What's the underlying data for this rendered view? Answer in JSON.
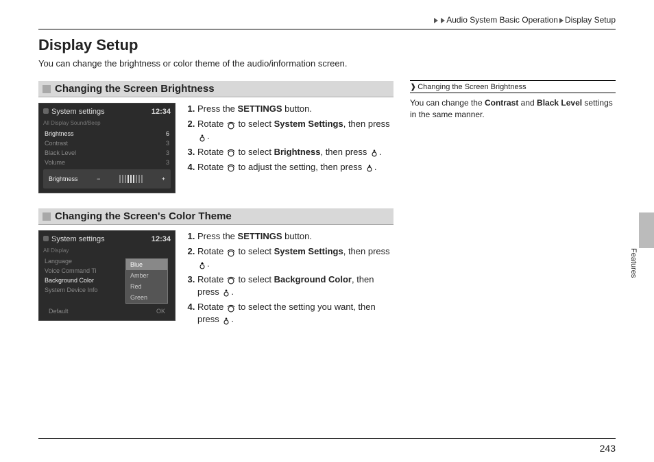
{
  "breadcrumb": {
    "a": "Audio System Basic Operation",
    "b": "Display Setup"
  },
  "title": "Display Setup",
  "intro": "You can change the brightness or color theme of the audio/information screen.",
  "section1": {
    "heading": "Changing the Screen Brightness",
    "screenshot": {
      "header": "System settings",
      "clock": "12:34",
      "tabs": "All     Display     Sound/Beep",
      "rows": [
        {
          "label": "Brightness",
          "val": "6",
          "active": true
        },
        {
          "label": "Contrast",
          "val": "3",
          "active": false
        },
        {
          "label": "Black Level",
          "val": "3",
          "active": false
        },
        {
          "label": "Volume",
          "val": "3",
          "active": false
        }
      ],
      "foot_label": "Brightness",
      "minus": "−",
      "plus": "+"
    },
    "steps": {
      "s1a": "Press the ",
      "s1b": "SETTINGS",
      "s1c": " button.",
      "s2a": "Rotate ",
      "s2b": " to select ",
      "s2c": "System Settings",
      "s2d": ", then press ",
      "s2e": ".",
      "s3a": "Rotate ",
      "s3b": " to select ",
      "s3c": "Brightness",
      "s3d": ", then press ",
      "s3e": ".",
      "s4a": "Rotate ",
      "s4b": " to adjust the setting, then press ",
      "s4c": "."
    }
  },
  "section2": {
    "heading": "Changing the Screen's Color Theme",
    "screenshot": {
      "header": "System settings",
      "clock": "12:34",
      "tabs": "All     Display",
      "rows": [
        {
          "label": "Language",
          "active": false
        },
        {
          "label": "Voice Command Ti",
          "active": false
        },
        {
          "label": "Background Color",
          "active": true
        },
        {
          "label": "System Device Info",
          "active": false
        }
      ],
      "popup": [
        "Blue",
        "Amber",
        "Red",
        "Green"
      ],
      "popup_selected": 0,
      "foot_left": "Default",
      "foot_right": "OK"
    },
    "steps": {
      "s1a": "Press the ",
      "s1b": "SETTINGS",
      "s1c": " button.",
      "s2a": "Rotate ",
      "s2b": " to select ",
      "s2c": "System Settings",
      "s2d": ", then press ",
      "s2e": ".",
      "s3a": "Rotate ",
      "s3b": " to select ",
      "s3c": "Background Color",
      "s3d": ", then press ",
      "s3e": ".",
      "s4a": "Rotate ",
      "s4b": " to select the setting you want, then press ",
      "s4c": "."
    }
  },
  "sidebar": {
    "header": "Changing the Screen Brightness",
    "text_a": "You can change the ",
    "text_b": "Contrast",
    "text_c": " and ",
    "text_d": "Black Level",
    "text_e": " settings in the same manner."
  },
  "tab_label": "Features",
  "page_number": "243"
}
